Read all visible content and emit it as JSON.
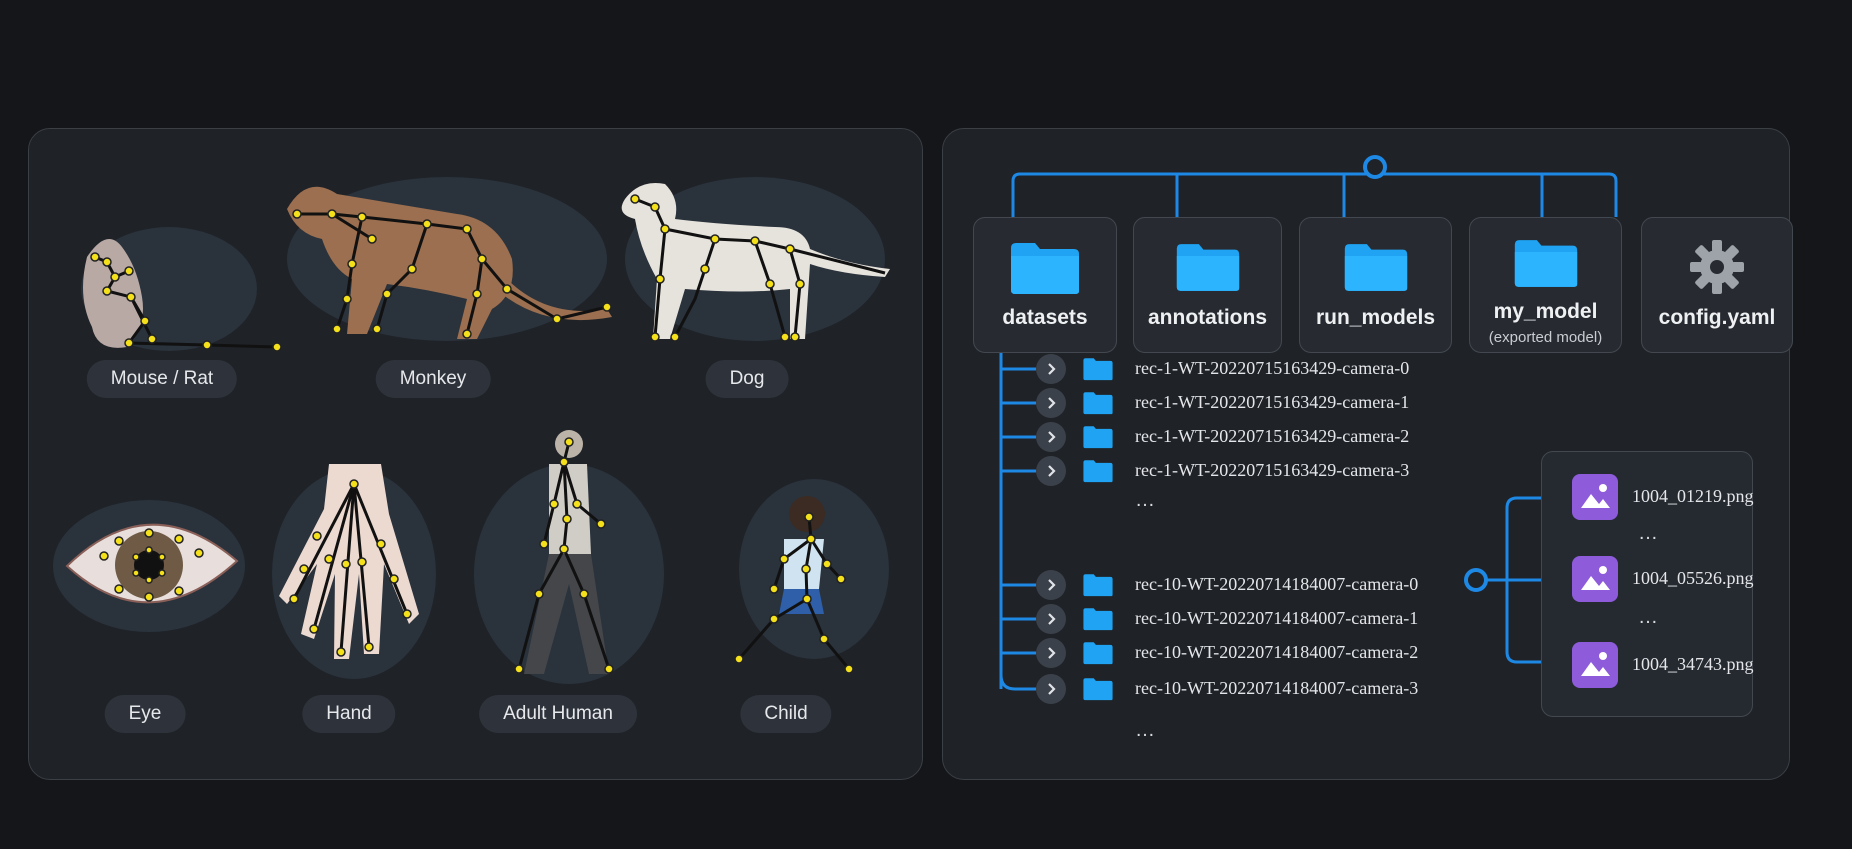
{
  "poses": {
    "mouse_rat": "Mouse / Rat",
    "monkey": "Monkey",
    "dog": "Dog",
    "eye": "Eye",
    "hand": "Hand",
    "adult_human": "Adult Human",
    "child": "Child"
  },
  "project_tree": {
    "folders": [
      {
        "label": "datasets",
        "icon": "folder-icon"
      },
      {
        "label": "annotations",
        "icon": "folder-icon"
      },
      {
        "label": "run_models",
        "icon": "folder-icon"
      },
      {
        "label": "my_model",
        "sublabel": "(exported model)",
        "icon": "folder-icon"
      },
      {
        "label": "config.yaml",
        "icon": "gear-icon"
      }
    ]
  },
  "recordings": {
    "items": [
      "rec-1-WT-20220715163429-camera-0",
      "rec-1-WT-20220715163429-camera-1",
      "rec-1-WT-20220715163429-camera-2",
      "rec-1-WT-20220715163429-camera-3",
      "rec-10-WT-20220714184007-camera-0",
      "rec-10-WT-20220714184007-camera-1",
      "rec-10-WT-20220714184007-camera-2",
      "rec-10-WT-20220714184007-camera-3"
    ],
    "ellipsis": "…"
  },
  "images": {
    "files": [
      "1004_01219.png",
      "1004_05526.png",
      "1004_34743.png"
    ],
    "ellipsis": "…"
  },
  "colors": {
    "accent": "#1e88e5",
    "folder": "#1fa3f2",
    "image_icon": "#8e5bdb",
    "keypoint": "#f5e11b"
  }
}
